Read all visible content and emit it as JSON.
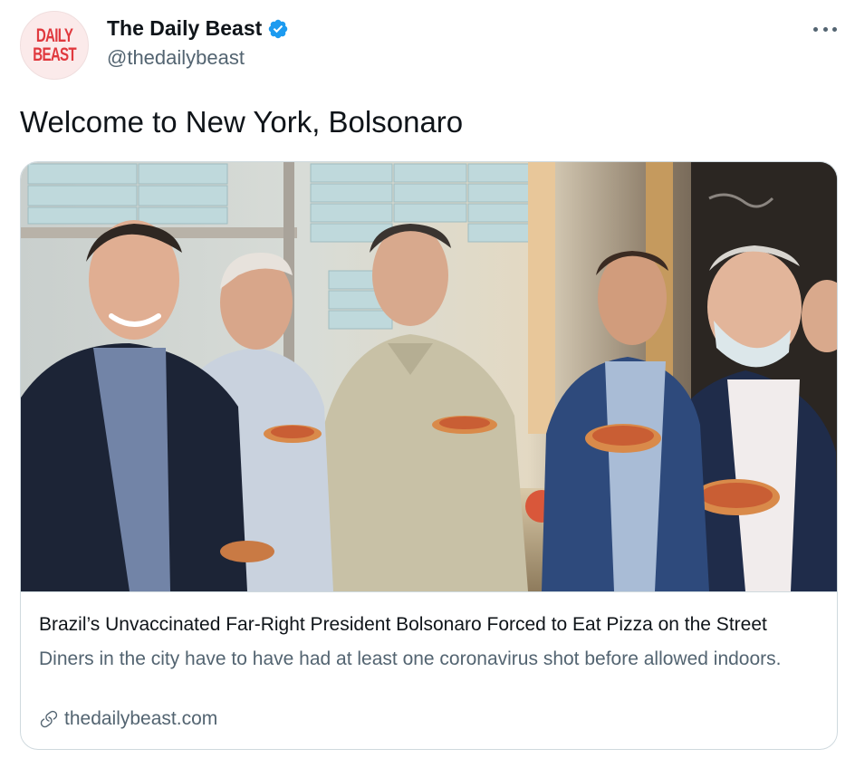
{
  "tweet": {
    "avatar_text": [
      "DAILY",
      "BEAST"
    ],
    "display_name": "The Daily Beast",
    "handle": "@thedailybeast",
    "verified": true,
    "more_icon": "more-horizontal-icon",
    "text": "Welcome to New York, Bolsonaro"
  },
  "card": {
    "image_alt": "",
    "title": "Brazil’s Unvaccinated Far-Right President Bolsonaro Forced to Eat Pizza on the Street",
    "description": "Diners in the city have to have had at least one coronavirus shot before allowed indoors.",
    "domain": "thedailybeast.com",
    "link_icon": "link-icon"
  },
  "colors": {
    "text_primary": "#0f1419",
    "text_secondary": "#536471",
    "verified_blue": "#1d9bf0",
    "border": "#cfd9de",
    "brand_red": "#e0393e"
  }
}
